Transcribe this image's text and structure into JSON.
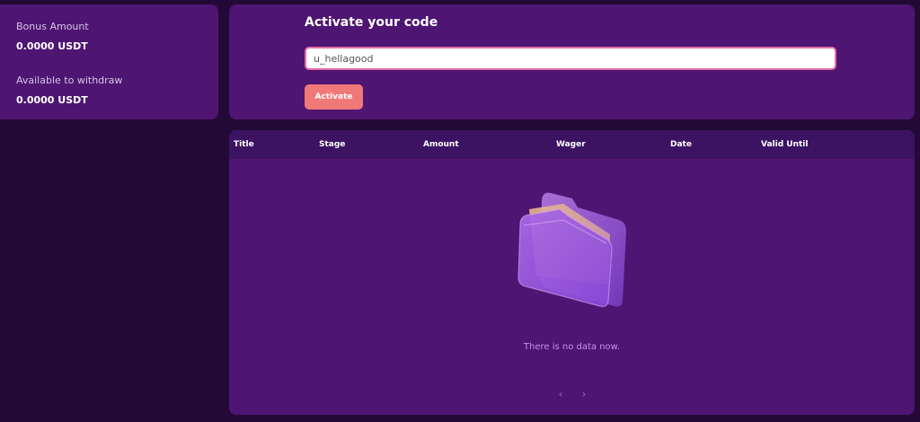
{
  "balances": {
    "bonus_label": "Bonus Amount",
    "bonus_value": "0.0000 USDT",
    "withdraw_label": "Available to withdraw",
    "withdraw_value": "0.0000 USDT"
  },
  "activate": {
    "title": "Activate your code",
    "code_value": "u_hellagood",
    "button_label": "Activate"
  },
  "table": {
    "columns": [
      "Title",
      "Stage",
      "Amount",
      "Wager",
      "Date",
      "Valid Until"
    ],
    "rows": [],
    "empty_text": "There is no data now.",
    "empty_icon": "folder-icon"
  },
  "pagination": {
    "prev_glyph": "‹",
    "next_glyph": "›"
  },
  "colors": {
    "background": "#230a36",
    "card": "#4e1572",
    "header": "#3c1262",
    "accent_button": "#f07878",
    "input_border": "#e26ea5",
    "empty_text": "#c78ef0"
  }
}
